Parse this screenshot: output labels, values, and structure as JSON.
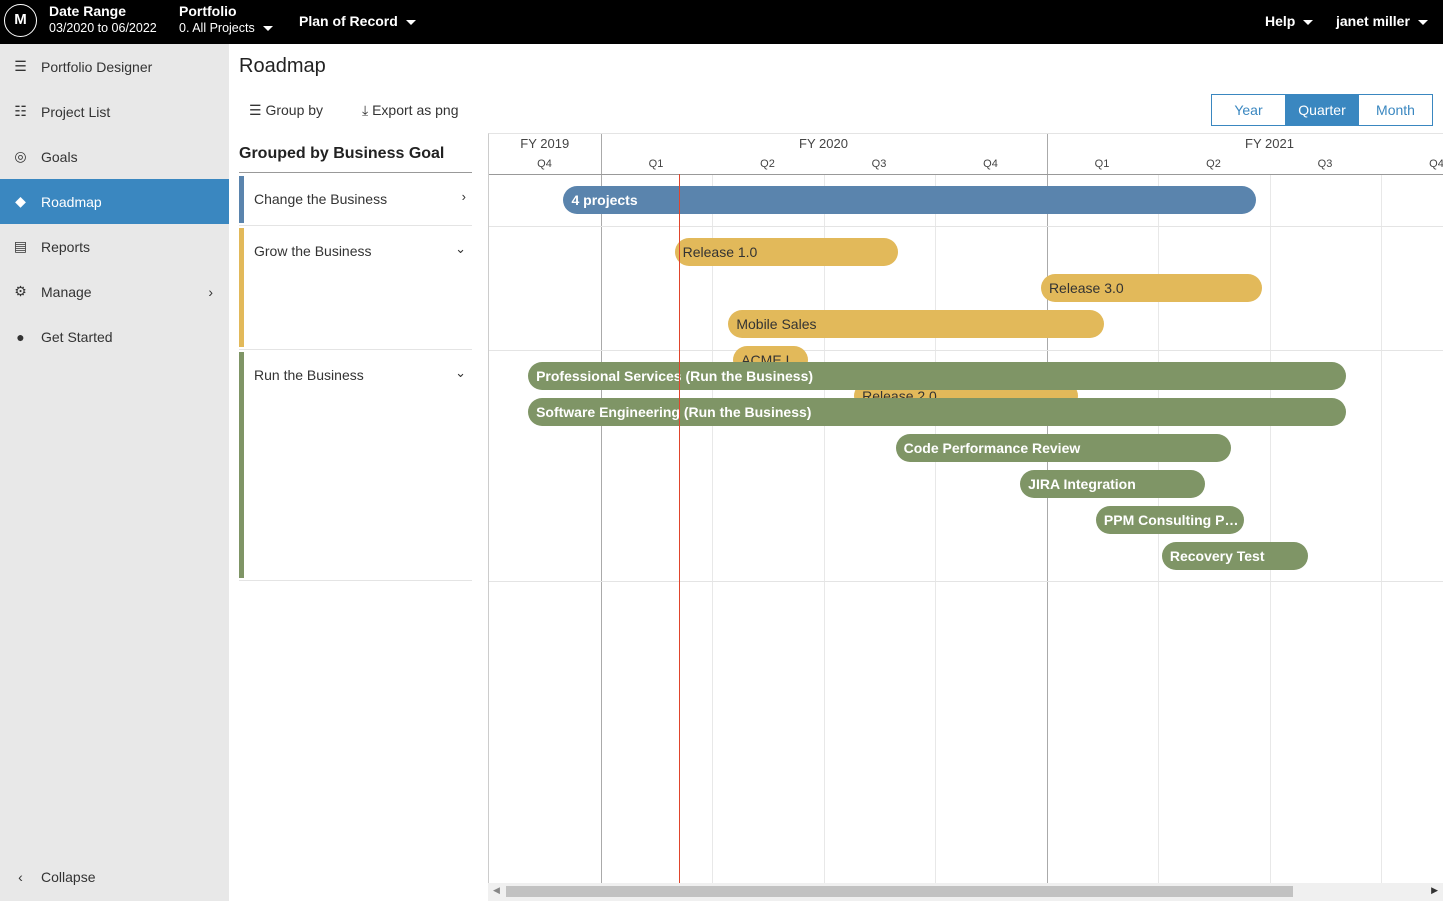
{
  "topbar": {
    "logo": "M",
    "date_range_label": "Date Range",
    "date_range_value": "03/2020 to 06/2022",
    "portfolio_label": "Portfolio",
    "portfolio_value": "0. All Projects",
    "plan": "Plan of Record",
    "help": "Help",
    "user": "janet miller"
  },
  "sidebar": {
    "items": [
      {
        "label": "Portfolio Designer",
        "icon": "portfolio-designer-icon",
        "glyph": "☰"
      },
      {
        "label": "Project List",
        "icon": "list-icon",
        "glyph": "☷"
      },
      {
        "label": "Goals",
        "icon": "target-icon",
        "glyph": "◎"
      },
      {
        "label": "Roadmap",
        "icon": "roadmap-icon",
        "glyph": "◆",
        "active": true
      },
      {
        "label": "Reports",
        "icon": "document-icon",
        "glyph": "▤"
      },
      {
        "label": "Manage",
        "icon": "gear-icon",
        "glyph": "⚙",
        "chevron": true
      },
      {
        "label": "Get Started",
        "icon": "compass-icon",
        "glyph": "●"
      }
    ],
    "collapse": "Collapse"
  },
  "page": {
    "title": "Roadmap",
    "group_by": "Group by",
    "export": "Export as png",
    "views": [
      "Year",
      "Quarter",
      "Month"
    ],
    "active_view": "Quarter",
    "grouped_heading": "Grouped by Business Goal"
  },
  "groups": [
    {
      "name": "Change the Business",
      "color": "#5a84ad",
      "expanded": false
    },
    {
      "name": "Grow the Business",
      "color": "#e2b95a",
      "expanded": true
    },
    {
      "name": "Run the Business",
      "color": "#7f9566",
      "expanded": true
    }
  ],
  "timeline": {
    "years": [
      {
        "label": "FY 2019",
        "quarters": [
          "Q4"
        ]
      },
      {
        "label": "FY 2020",
        "quarters": [
          "Q1",
          "Q2",
          "Q3",
          "Q4"
        ]
      },
      {
        "label": "FY 2021",
        "quarters": [
          "Q1",
          "Q2",
          "Q3",
          "Q4"
        ]
      }
    ],
    "today": "2020-03-05",
    "bars": [
      {
        "label": "4 projects",
        "group": 0,
        "start": "2019-12-01",
        "end": "2021-06-20"
      },
      {
        "label": "Release 1.0",
        "group": 1,
        "start": "2020-03-01",
        "end": "2020-08-31"
      },
      {
        "label": "Release 3.0",
        "group": 1,
        "start": "2020-12-26",
        "end": "2021-06-25"
      },
      {
        "label": "Mobile Sales",
        "group": 1,
        "start": "2020-04-14",
        "end": "2021-02-16"
      },
      {
        "label": "ACME In...",
        "group": 1,
        "start": "2020-04-18",
        "end": "2020-06-18"
      },
      {
        "label": "Release 2.0",
        "group": 1,
        "start": "2020-07-26",
        "end": "2021-01-25"
      },
      {
        "label": "Professional Services (Run the Business)",
        "group": 2,
        "start": "2019-11-02",
        "end": "2021-09-02"
      },
      {
        "label": "Software Engineering (Run the Business)",
        "group": 2,
        "start": "2019-11-02",
        "end": "2021-09-02"
      },
      {
        "label": "Code Performance Review",
        "group": 2,
        "start": "2020-08-29",
        "end": "2021-05-31"
      },
      {
        "label": "JIRA Integration",
        "group": 2,
        "start": "2020-12-09",
        "end": "2021-05-09"
      },
      {
        "label": "PPM Consulting Pro...",
        "group": 2,
        "start": "2021-02-09",
        "end": "2021-06-10"
      },
      {
        "label": "Recovery Test",
        "group": 2,
        "start": "2021-04-04",
        "end": "2021-08-02"
      }
    ]
  }
}
